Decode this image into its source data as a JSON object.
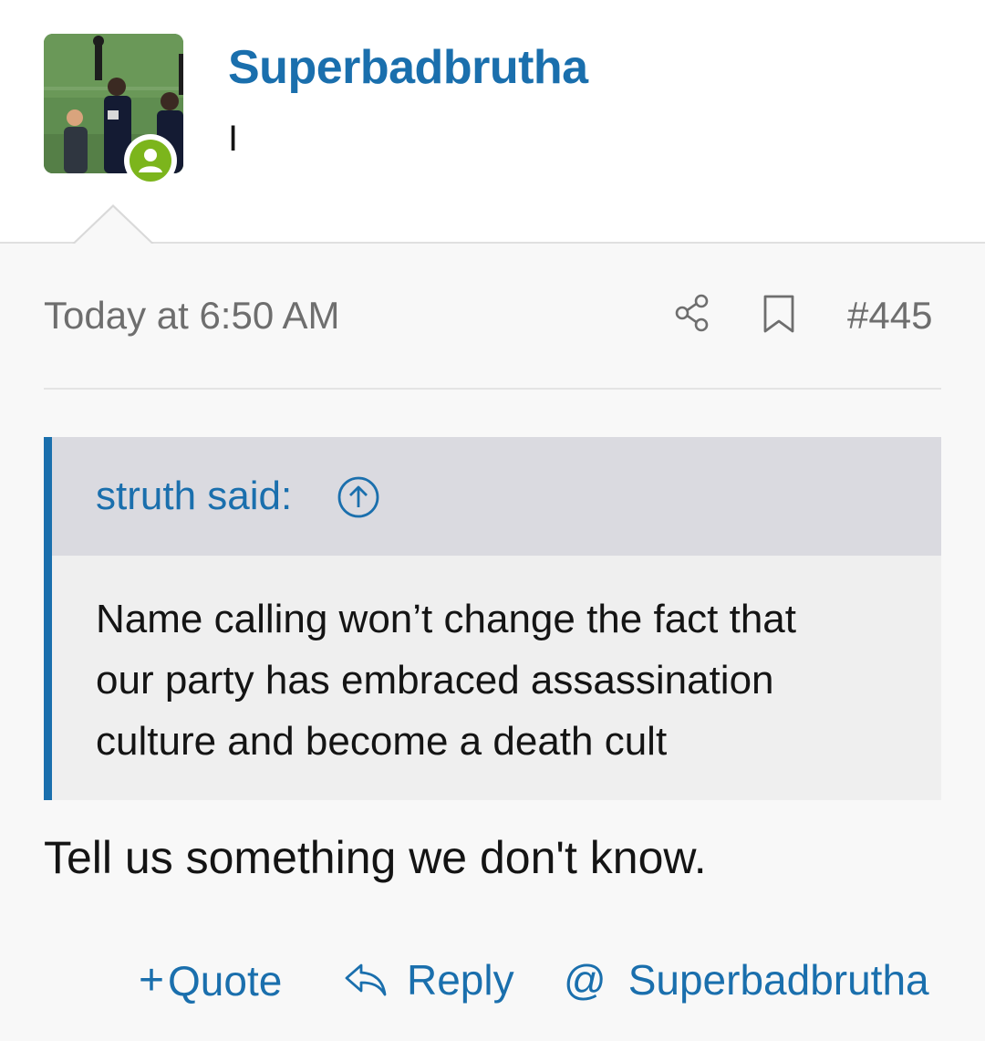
{
  "user": {
    "name": "Superbadbrutha",
    "title": "I"
  },
  "post": {
    "timestamp": "Today at 6:50 AM",
    "number": "#445",
    "message": "Tell us something we don't know."
  },
  "quote": {
    "author": "struth said:",
    "lines": [
      "Name calling won’t change the fact that",
      "our party has embraced assassination",
      "culture and become a death cult"
    ]
  },
  "actions": {
    "quote_plus": "+",
    "quote_label": "Quote",
    "reply_label": "Reply",
    "mention_at": "@",
    "mention_label": "Superbadbrutha"
  },
  "icons": {
    "share": "share-icon",
    "bookmark": "bookmark-icon",
    "jump_to_quote": "arrow-up-circle-icon",
    "reply": "reply-arrow-icon",
    "online_status": "user-icon"
  },
  "colors": {
    "accent": "#1a6fad",
    "online": "#7cb51c",
    "quote_header": "#dadae0",
    "quote_body": "#efefef",
    "muted_text": "#6e6e6e"
  }
}
